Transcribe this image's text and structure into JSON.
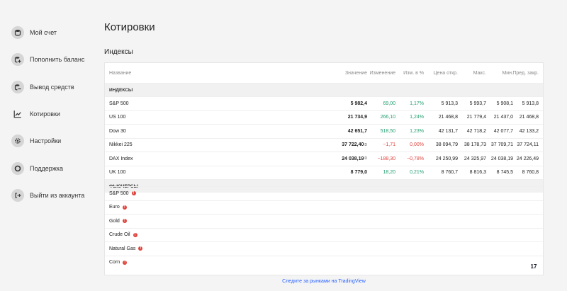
{
  "sidebar": {
    "items": [
      {
        "label": "Мой счет",
        "icon": "database-icon"
      },
      {
        "label": "Пополнить баланс",
        "icon": "database-plus-icon"
      },
      {
        "label": "Вывод средств",
        "icon": "database-minus-icon"
      },
      {
        "label": "Котировки",
        "icon": "chart-line-icon"
      },
      {
        "label": "Настройки",
        "icon": "gear-icon"
      },
      {
        "label": "Поддержка",
        "icon": "lifebuoy-icon"
      },
      {
        "label": "Выйти из аккаунта",
        "icon": "logout-icon"
      }
    ]
  },
  "page": {
    "title": "Котировки",
    "section_title": "Индексы"
  },
  "table": {
    "headers": {
      "name": "Название",
      "value": "Значение",
      "change": "Изменение",
      "pct": "Изм. в %",
      "open": "Цена откр.",
      "max": "Макс.",
      "min": "Мин.",
      "prev": "Пред. закр."
    },
    "group_indices": "ИНДЕКСЫ",
    "indices": [
      {
        "name": "S&P 500",
        "value": "5 982,4",
        "change": "69,00",
        "pct": "1,17%",
        "open": "5 913,3",
        "max": "5 993,7",
        "min": "5 908,1",
        "prev": "5 913,8",
        "dir": "up",
        "delayed": false
      },
      {
        "name": "US 100",
        "value": "21 734,9",
        "change": "266,10",
        "pct": "1,24%",
        "open": "21 468,8",
        "max": "21 779,4",
        "min": "21 437,0",
        "prev": "21 468,8",
        "dir": "up",
        "delayed": false
      },
      {
        "name": "Dow 30",
        "value": "42 651,7",
        "change": "518,50",
        "pct": "1,23%",
        "open": "42 131,7",
        "max": "42 718,2",
        "min": "42 077,7",
        "prev": "42 133,2",
        "dir": "up",
        "delayed": false
      },
      {
        "name": "Nikkei 225",
        "value": "37 722,40",
        "change": "−1,71",
        "pct": "0,00%",
        "open": "38 094,79",
        "max": "38 178,73",
        "min": "37 709,71",
        "prev": "37 724,11",
        "dir": "down",
        "delayed": true
      },
      {
        "name": "DAX Index",
        "value": "24 038,19",
        "change": "−188,30",
        "pct": "−0,78%",
        "open": "24 250,99",
        "max": "24 325,97",
        "min": "24 038,19",
        "prev": "24 226,49",
        "dir": "down",
        "delayed": true
      },
      {
        "name": "UK 100",
        "value": "8 779,0",
        "change": "18,20",
        "pct": "0,21%",
        "open": "8 760,7",
        "max": "8 816,3",
        "min": "8 745,5",
        "prev": "8 760,8",
        "dir": "up",
        "delayed": false
      }
    ],
    "delayed_marker": "D",
    "group_futures": "ФЬЮЧЕРСЫ",
    "futures": [
      {
        "name": "S&P 500"
      },
      {
        "name": "Euro"
      },
      {
        "name": "Gold"
      },
      {
        "name": "Crude Oil"
      },
      {
        "name": "Natural Gas"
      },
      {
        "name": "Corn"
      }
    ],
    "warn_glyph": "!"
  },
  "widget": {
    "logo_text": "17",
    "footer_link": "Следите за рынками на TradingView"
  },
  "colors": {
    "positive": "#1f9e6e",
    "negative": "#e0433c",
    "link": "#2962ff"
  }
}
